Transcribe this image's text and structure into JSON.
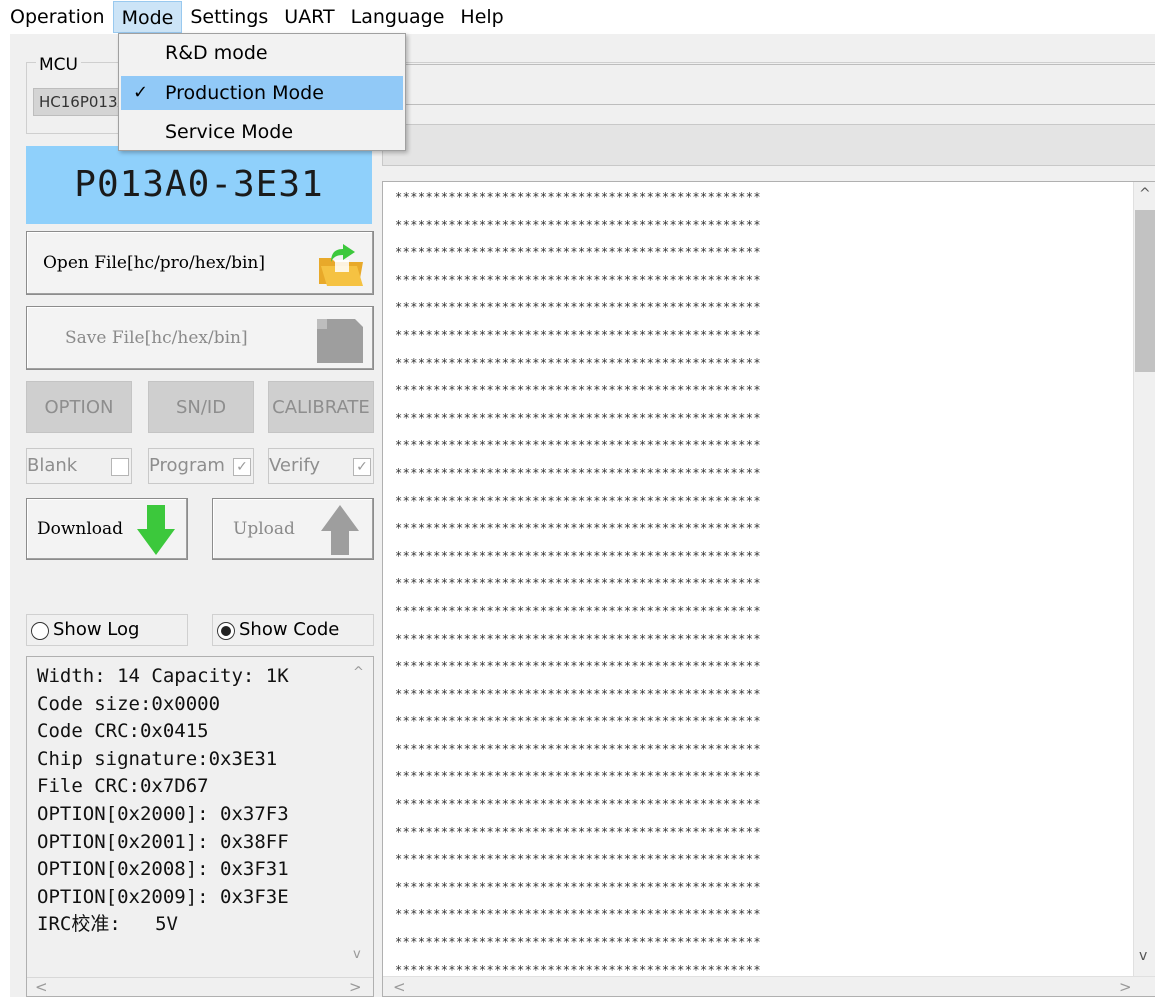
{
  "menubar": {
    "items": [
      "Operation",
      "Mode",
      "Settings",
      "UART",
      "Language",
      "Help"
    ]
  },
  "mode_menu": {
    "items": [
      {
        "label": "R&D mode",
        "checked": false
      },
      {
        "label": "Production Mode",
        "checked": true
      },
      {
        "label": "Service Mode",
        "checked": false
      }
    ],
    "check_glyph": "✓"
  },
  "mcu": {
    "legend": "MCU",
    "value": "HC16P013A0"
  },
  "chip_id": "P013A0-3E31",
  "buttons": {
    "open_file": "Open File[hc/pro/hex/bin]",
    "save_file": "Save File[hc/hex/bin]",
    "option": "OPTION",
    "sn_id": "SN/ID",
    "calibrate": "CALIBRATE",
    "download": "Download",
    "upload": "Upload"
  },
  "checks": {
    "blank": {
      "label": "Blank",
      "checked": false
    },
    "program": {
      "label": "Program",
      "checked": true
    },
    "verify": {
      "label": "Verify",
      "checked": true
    },
    "check_glyph": "✓"
  },
  "view": {
    "show_log": "Show Log",
    "show_code": "Show Code",
    "selected": "show_code"
  },
  "info": {
    "lines": [
      "Width: 14 Capacity: 1K",
      "Code size:0x0000",
      "Code CRC:0x0415",
      "Chip signature:0x3E31",
      "File CRC:0x7D67",
      "OPTION[0x2000]: 0x37F3",
      "OPTION[0x2001]: 0x38FF",
      "OPTION[0x2008]: 0x3F31",
      "OPTION[0x2009]: 0x3F3E",
      "IRC校准:   5V"
    ]
  },
  "code_view": {
    "line_text": "************************************************",
    "line_count": 29
  },
  "scroll_glyphs": {
    "up": "^",
    "down": "v",
    "left": "<",
    "right": ">"
  },
  "colors": {
    "chip_id_bg": "#8fd0fb",
    "menu_selected_bg": "#91c9f7",
    "download_arrow": "#3cc83c",
    "folder": "#f5c242"
  },
  "icons": {
    "open_file": "folder-open-icon",
    "save_file": "save-disk-icon",
    "download": "download-arrow-icon",
    "upload": "upload-arrow-icon"
  }
}
